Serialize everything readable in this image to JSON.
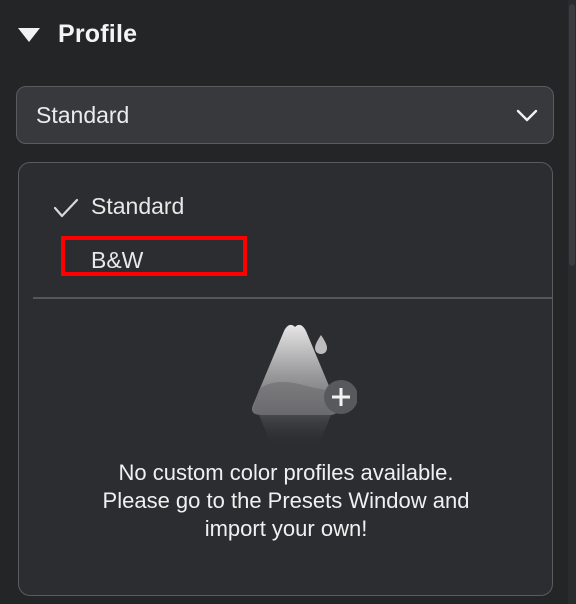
{
  "section": {
    "title": "Profile"
  },
  "profile_select": {
    "value": "Standard"
  },
  "menu": {
    "items": [
      {
        "label": "Standard",
        "checked": true
      },
      {
        "label": "B&W",
        "checked": false
      }
    ],
    "empty_message": "No custom color profiles available. Please go to the Presets Window and import your own!"
  },
  "colors": {
    "background": "#242527",
    "panel": "#2c2d30",
    "select": "#38393c",
    "border": "#5a5b5e",
    "highlight": "#ff0000"
  },
  "icons": {
    "section_toggle": "triangle-down-icon",
    "select_chevron": "chevron-down-icon",
    "checked": "checkmark-icon",
    "empty_state": "mountain-plus-icon"
  }
}
